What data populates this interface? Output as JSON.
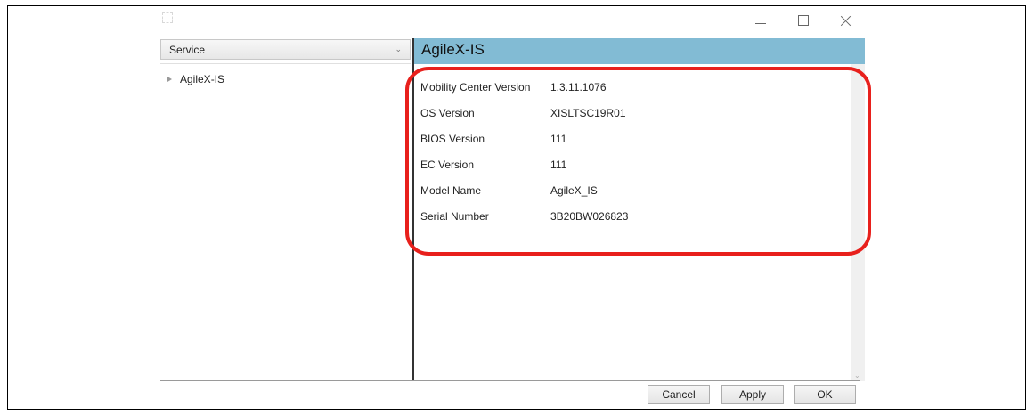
{
  "window": {
    "controls": {
      "minimize_icon": "minimize-icon",
      "maximize_icon": "maximize-icon",
      "close_icon": "close-icon"
    }
  },
  "sidebar": {
    "select": {
      "selected": "Service"
    },
    "tree": [
      {
        "label": "AgileX-IS"
      }
    ]
  },
  "main": {
    "header_title": "AgileX-IS",
    "header_color": "#82bbd4",
    "info": [
      {
        "label": "Mobility Center Version",
        "value": "1.3.11.1076"
      },
      {
        "label": "OS Version",
        "value": "XISLTSC19R01"
      },
      {
        "label": "BIOS Version",
        "value": "111"
      },
      {
        "label": "EC Version",
        "value": "111"
      },
      {
        "label": "Model Name",
        "value": "AgileX_IS"
      },
      {
        "label": "Serial Number",
        "value": "3B20BW026823"
      }
    ],
    "highlight_color": "#e8201c"
  },
  "footer": {
    "cancel_label": "Cancel",
    "apply_label": "Apply",
    "ok_label": "OK"
  }
}
